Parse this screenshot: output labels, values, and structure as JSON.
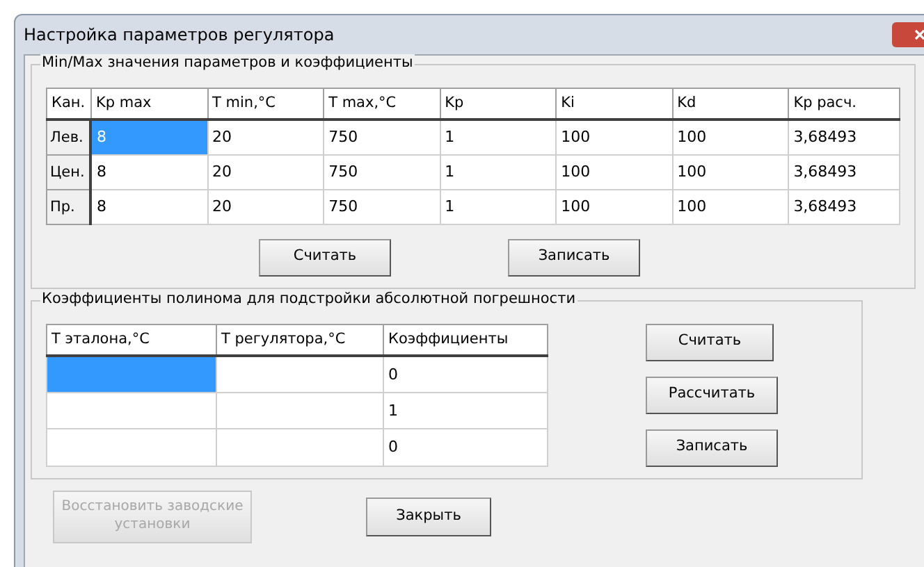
{
  "window": {
    "title": "Настройка параметров регулятора"
  },
  "params_group": {
    "title": "Min/Max значения параметров и коэффициенты",
    "columns": [
      "Кан.",
      "Kp max",
      "T min,°C",
      "T max,°C",
      "Kp",
      "Ki",
      "Kd",
      "Kp расч."
    ],
    "rows": [
      {
        "cells": [
          {
            "kind": "header",
            "text": "Лев.",
            "selected": false
          },
          {
            "kind": "data",
            "text": "8",
            "selected": true
          },
          {
            "kind": "data",
            "text": "20",
            "selected": false
          },
          {
            "kind": "data",
            "text": "750",
            "selected": false
          },
          {
            "kind": "data",
            "text": "1",
            "selected": false
          },
          {
            "kind": "data",
            "text": "100",
            "selected": false
          },
          {
            "kind": "data",
            "text": "100",
            "selected": false
          },
          {
            "kind": "data",
            "text": "3,68493",
            "selected": false
          }
        ]
      },
      {
        "cells": [
          {
            "kind": "header",
            "text": "Цен.",
            "selected": false
          },
          {
            "kind": "data",
            "text": "8",
            "selected": false
          },
          {
            "kind": "data",
            "text": "20",
            "selected": false
          },
          {
            "kind": "data",
            "text": "750",
            "selected": false
          },
          {
            "kind": "data",
            "text": "1",
            "selected": false
          },
          {
            "kind": "data",
            "text": "100",
            "selected": false
          },
          {
            "kind": "data",
            "text": "100",
            "selected": false
          },
          {
            "kind": "data",
            "text": "3,68493",
            "selected": false
          }
        ]
      },
      {
        "cells": [
          {
            "kind": "header",
            "text": "Пр.",
            "selected": false
          },
          {
            "kind": "data",
            "text": "8",
            "selected": false
          },
          {
            "kind": "data",
            "text": "20",
            "selected": false
          },
          {
            "kind": "data",
            "text": "750",
            "selected": false
          },
          {
            "kind": "data",
            "text": "1",
            "selected": false
          },
          {
            "kind": "data",
            "text": "100",
            "selected": false
          },
          {
            "kind": "data",
            "text": "100",
            "selected": false
          },
          {
            "kind": "data",
            "text": "3,68493",
            "selected": false
          }
        ]
      }
    ],
    "buttons": [
      "Считать",
      "Записать"
    ]
  },
  "poly_group": {
    "title": "Коэффициенты полинома для подстройки абсолютной погрешности",
    "columns": [
      "T эталона,°C",
      "T регулятора,°C",
      "Коэффициенты"
    ],
    "rows": [
      {
        "cells": [
          {
            "text": null,
            "selected": true
          },
          {
            "text": null,
            "selected": false
          },
          {
            "text": "0",
            "selected": false
          }
        ]
      },
      {
        "cells": [
          {
            "text": null,
            "selected": false
          },
          {
            "text": null,
            "selected": false
          },
          {
            "text": "1",
            "selected": false
          }
        ]
      },
      {
        "cells": [
          {
            "text": null,
            "selected": false
          },
          {
            "text": null,
            "selected": false
          },
          {
            "text": "0",
            "selected": false
          }
        ]
      }
    ],
    "buttons": [
      "Считать",
      "Рассчитать",
      "Записать"
    ]
  },
  "footer_buttons": [
    {
      "label": "Восстановить заводские установки",
      "disabled": true
    },
    {
      "label": "Закрыть",
      "disabled": false
    }
  ]
}
